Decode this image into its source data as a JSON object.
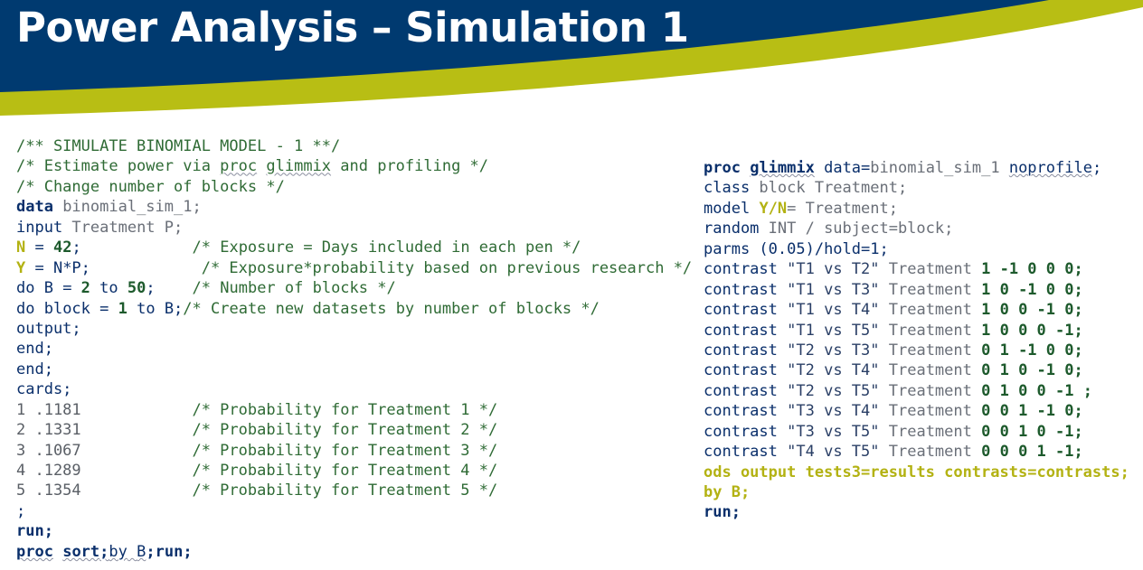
{
  "title": "Power Analysis – Simulation 1",
  "colors": {
    "navy": "#003a70",
    "accent": "#b8be14",
    "comment": "#2f6b35",
    "keyword": "#0a2f6b"
  },
  "left_code": {
    "l1": "/** SIMULATE BINOMIAL MODEL - 1 **/",
    "l2a": "/* Estimate power via ",
    "l2b": "proc",
    "l2c": " ",
    "l2d": "glimmix",
    "l2e": " and profiling */",
    "l3": "/* Change number of blocks */",
    "l4a": "data",
    "l4b": " binomial_sim_1;",
    "l5a": "input",
    "l5b": " Treatment P;",
    "l6a": "N",
    "l6b": " = ",
    "l6c": "42",
    "l6d": ";            ",
    "l6e": "/* Exposure = Days included in each pen */",
    "l7a": "Y",
    "l7b": " = N*P;            ",
    "l7c": "/* Exposure*probability based on previous research */",
    "l8a": "do",
    "l8b": " B = ",
    "l8c": "2",
    "l8d": " to ",
    "l8e": "50",
    "l8f": ";    ",
    "l8g": "/* Number of blocks */",
    "l9a": "do",
    "l9b": " block = ",
    "l9c": "1",
    "l9d": " to ",
    "l9e": "B;",
    "l9f": "/* Create new datasets by number of blocks */",
    "l10": "output;",
    "l11": "end;",
    "l12": "end;",
    "l13": "cards;",
    "c1a": "1 .1181            ",
    "c1b": "/* Probability for Treatment 1 */",
    "c2a": "2 .1331            ",
    "c2b": "/* Probability for Treatment 2 */",
    "c3a": "3 .1067            ",
    "c3b": "/* Probability for Treatment 3 */",
    "c4a": "4 .1289            ",
    "c4b": "/* Probability for Treatment 4 */",
    "c5a": "5 .1354            ",
    "c5b": "/* Probability for Treatment 5 */",
    "l19": ";",
    "l20": "run;",
    "l21a": "proc",
    "l21b": " ",
    "l21c": "sort",
    "l21d": ";",
    "l21e": "by",
    "l21f": " ",
    "l21g": "B",
    "l21h": ";",
    "l21i": "run",
    "l21j": ";"
  },
  "right_code": {
    "r1a": "proc",
    "r1b": " ",
    "r1c": "glimmix",
    "r1d": " data=",
    "r1e": "binomial_sim_1",
    "r1f": " ",
    "r1g": "noprofile",
    "r1h": ";",
    "r2a": "class",
    "r2b": " block Treatment;",
    "r3a": "model",
    "r3b": " ",
    "r3c": "Y/N",
    "r3d": "= Treatment;",
    "r4a": "random",
    "r4b": " INT / subject=block;",
    "r5a": "parms",
    "r5b": " (0.05)/hold=1;",
    "contrasts": [
      {
        "kw": "contrast",
        "label": "\"T1 vs T2\"",
        "var": "Treatment",
        "coef": "1 -1 0 0 0;"
      },
      {
        "kw": "contrast",
        "label": "\"T1 vs T3\"",
        "var": "Treatment",
        "coef": "1 0 -1 0 0;"
      },
      {
        "kw": "contrast",
        "label": "\"T1 vs T4\"",
        "var": "Treatment",
        "coef": "1 0 0 -1 0;"
      },
      {
        "kw": "contrast",
        "label": "\"T1 vs T5\"",
        "var": "Treatment",
        "coef": "1 0 0 0 -1;"
      },
      {
        "kw": "contrast",
        "label": "\"T2 vs T3\"",
        "var": "Treatment",
        "coef": "0 1 -1 0 0;"
      },
      {
        "kw": "contrast",
        "label": "\"T2 vs T4\"",
        "var": "Treatment",
        "coef": "0 1 0 -1 0;"
      },
      {
        "kw": "contrast",
        "label": "\"T2 vs T5\"",
        "var": "Treatment",
        "coef": "0 1 0 0 -1 ;"
      },
      {
        "kw": "contrast",
        "label": "\"T3 vs T4\"",
        "var": "Treatment",
        "coef": "0 0 1 -1 0;"
      },
      {
        "kw": "contrast",
        "label": "\"T3 vs T5\"",
        "var": "Treatment",
        "coef": "0 0 1 0 -1;"
      },
      {
        "kw": "contrast",
        "label": "\"T4 vs T5\"",
        "var": "Treatment",
        "coef": "0 0 0 1 -1;"
      }
    ],
    "r16": "ods output tests3=results contrasts=contrasts;",
    "r17": "by B;",
    "r18": "run;"
  }
}
